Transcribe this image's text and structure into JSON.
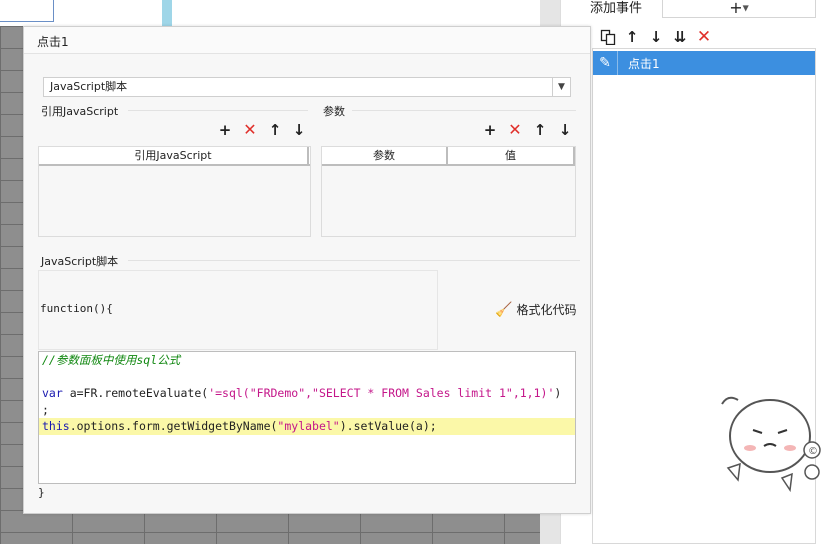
{
  "dialog": {
    "title": "点击1",
    "script_type": "JavaScript脚本",
    "ref_js_label": "引用JavaScript",
    "params_label": "参数",
    "ref_js_col": "引用JavaScript",
    "param_cols": [
      "参数",
      "值"
    ],
    "script_label": "JavaScript脚本",
    "function_head": "function(){",
    "format_button": "格式化代码",
    "closing": "}",
    "code": {
      "comment": "//参数面板中使用sql公式",
      "line2_kw": "var",
      "line2_a": " a=FR.remoteEvaluate(",
      "line2_str": "'=sql(\"FRDemo\",\"SELECT * FROM Sales limit 1\",1,1)'",
      "line2_b": ")",
      "line3": ";",
      "line4_kw": "this",
      "line4_a": ".options.form.getWidgetByName(",
      "line4_str": "\"mylabel\"",
      "line4_b": ").setValue(a);"
    }
  },
  "event_panel": {
    "title": "添加事件",
    "add_symbol": "+",
    "items": [
      {
        "label": "点击1"
      }
    ]
  },
  "colors": {
    "accent": "#3c8fe0",
    "delete": "#e0302b",
    "highlight": "#fbf8a8"
  }
}
